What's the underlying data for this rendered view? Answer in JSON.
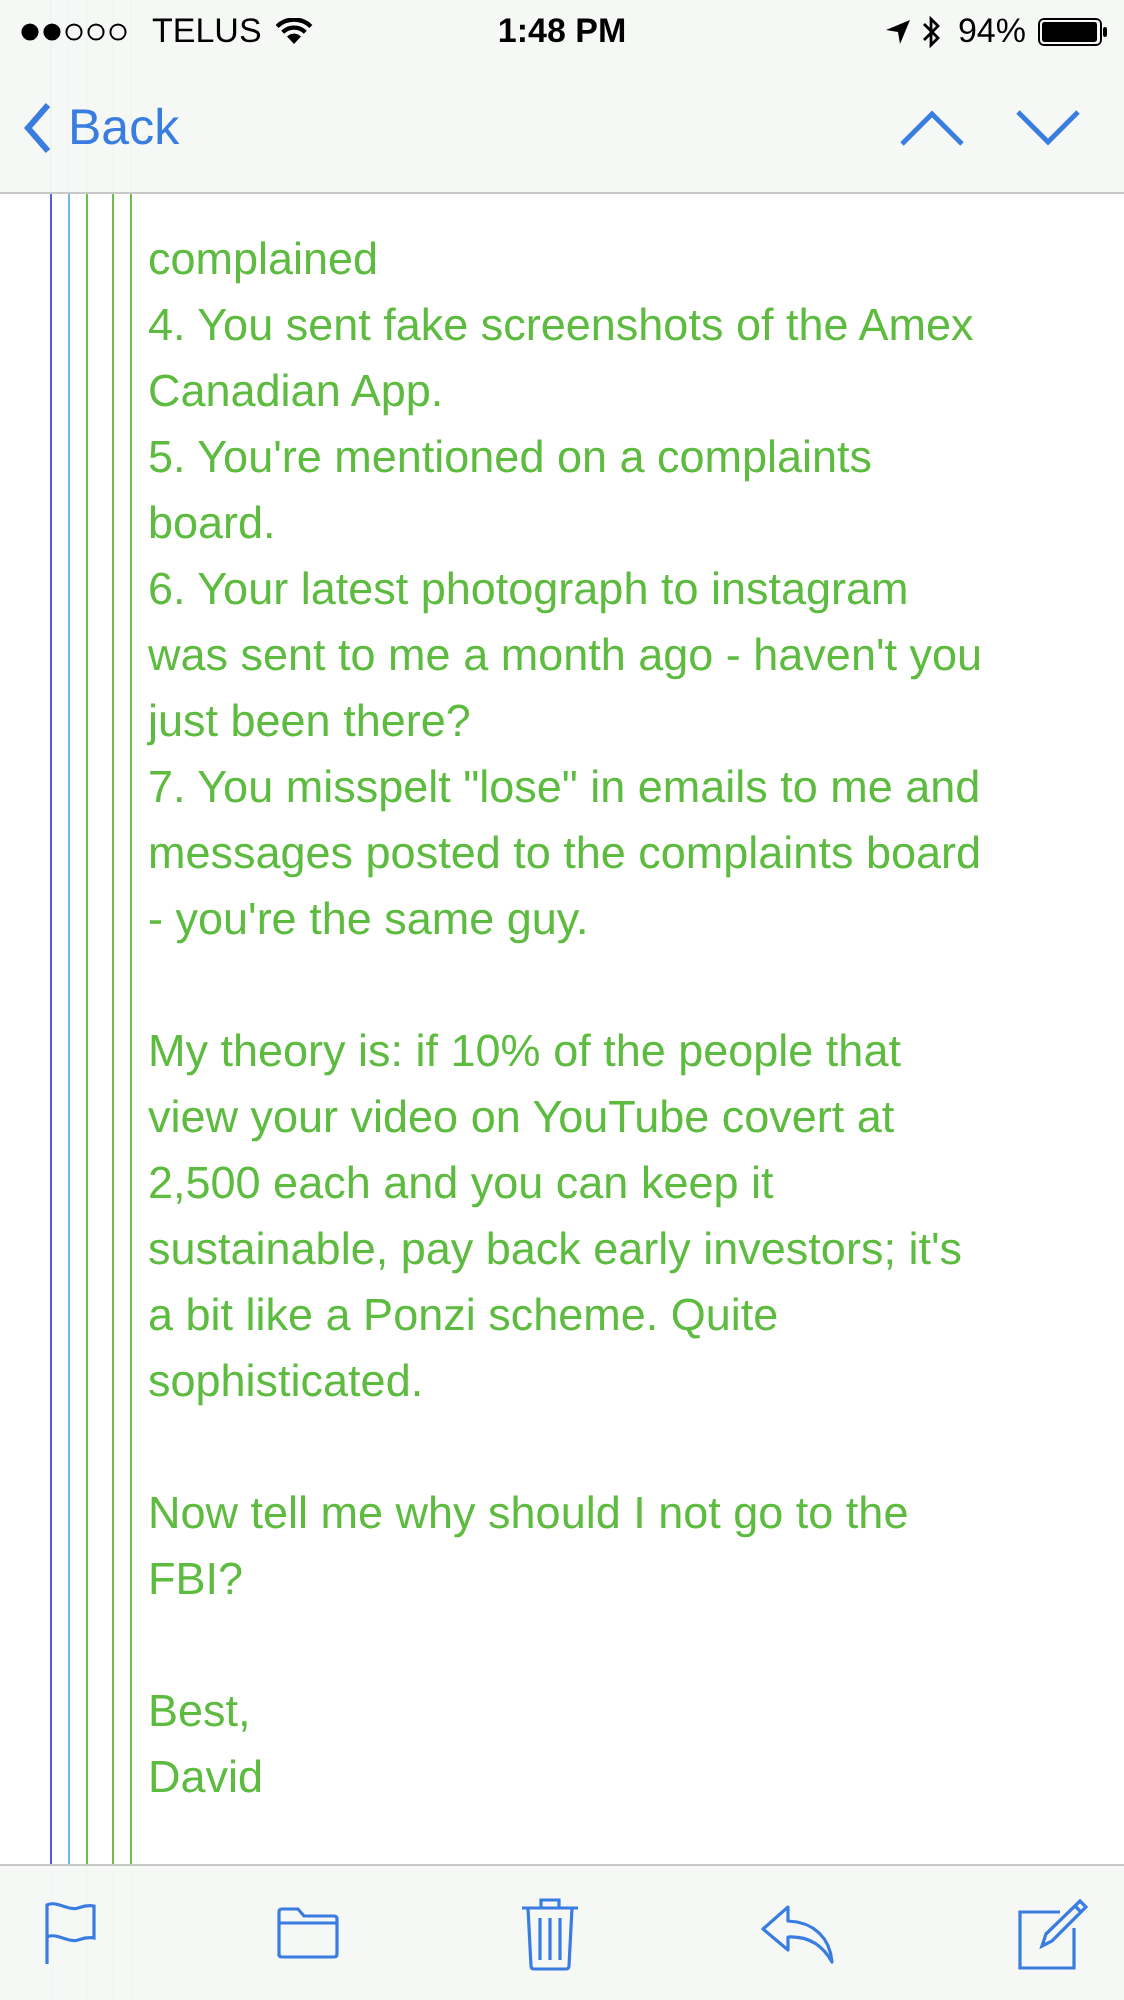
{
  "status_bar": {
    "carrier": "TELUS",
    "time": "1:48 PM",
    "battery": "94%"
  },
  "nav_bar": {
    "back_label": "Back"
  },
  "message": {
    "paragraphs": [
      {
        "text": "complained\n4. You sent fake screenshots of the Amex\nCanadian App.\n5. You're mentioned on a complaints\nboard.\n6. Your latest photograph to instagram\nwas sent to me a month ago - haven't you\njust been there?\n7. You misspelt \"lose\" in emails to me and\nmessages posted to the complaints board\n- you're the same guy."
      },
      {
        "text": "My theory is: if 10% of the people that\nview your video on YouTube covert at\n2,500 each and you can keep it\nsustainable, pay back early investors; it's\na bit like a Ponzi scheme.  Quite\nsophisticated."
      },
      {
        "text": "Now tell me why should I not go to the\nFBI?"
      },
      {
        "text": "Best,\nDavid"
      }
    ]
  }
}
